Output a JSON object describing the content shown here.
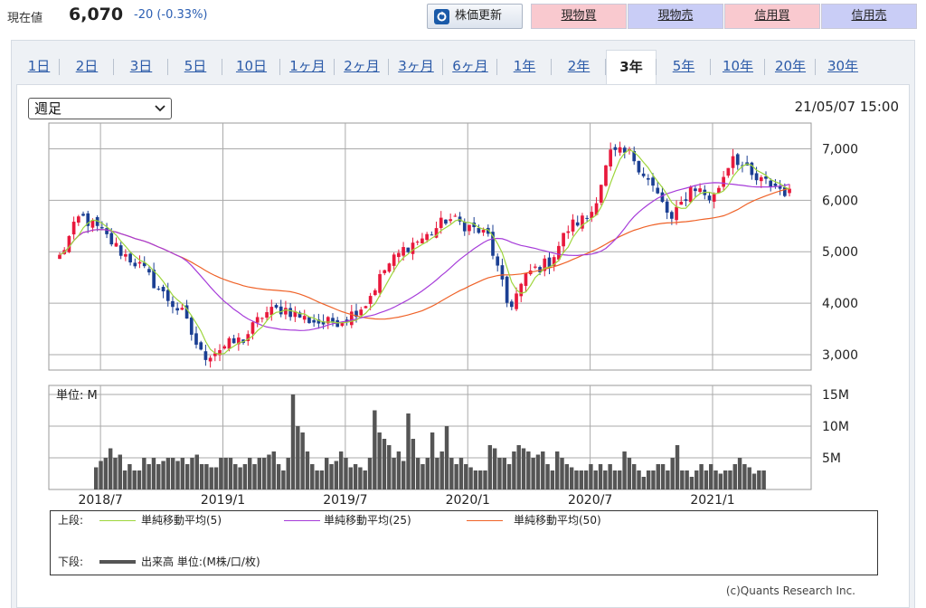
{
  "quote": {
    "price_label": "現在値",
    "price_value": "6,070",
    "price_change": "-20 (-0.33%)"
  },
  "buttons": {
    "refresh": "株価更新",
    "spot_buy": "現物買",
    "spot_sell": "現物売",
    "margin_buy": "信用買",
    "margin_sell": "信用売"
  },
  "tabs": [
    "1日",
    "2日",
    "3日",
    "5日",
    "10日",
    "1ヶ月",
    "2ヶ月",
    "3ヶ月",
    "6ヶ月",
    "1年",
    "2年",
    "3年",
    "5年",
    "10年",
    "20年",
    "30年"
  ],
  "active_tab": "3年",
  "interval_select": "週足",
  "timestamp": "21/05/07 15:00",
  "legend": {
    "upper_label": "上段:",
    "lower_label": "下段:",
    "ma5": "単純移動平均(5)",
    "ma25": "単純移動平均(25)",
    "ma50": "単純移動平均(50)",
    "volume": "出来高 単位:(M株/口/枚)"
  },
  "copyright": "(c)Quants Research Inc.",
  "colors": {
    "up": "#e8193c",
    "down": "#1b3f93",
    "ma5": "#9ed63c",
    "ma25": "#a63cd9",
    "ma50": "#ef6228",
    "volume": "#555555",
    "grid": "#aaaaaa"
  },
  "chart_data": [
    {
      "type": "candlestick",
      "title": "",
      "y_ticks": [
        "7,000",
        "6,000",
        "5,000",
        "4,000",
        "3,000"
      ],
      "y_tick_values": [
        7000,
        6000,
        5000,
        4000,
        3000
      ],
      "ylim": [
        2700,
        7500
      ],
      "x_ticks": [
        "2018/7",
        "2019/1",
        "2019/7",
        "2020/1",
        "2020/7",
        "2021/1"
      ],
      "x_range": [
        "2018/5",
        "2021/5"
      ],
      "keypoints": [
        {
          "date": "2018/5",
          "close": 4900
        },
        {
          "date": "2018/6",
          "close": 5700
        },
        {
          "date": "2018/7",
          "close": 5400
        },
        {
          "date": "2018/8",
          "close": 5000
        },
        {
          "date": "2018/9",
          "close": 4700
        },
        {
          "date": "2018/10",
          "close": 4200
        },
        {
          "date": "2018/11",
          "close": 3800
        },
        {
          "date": "2018/12",
          "close": 2950
        },
        {
          "date": "2019/1",
          "close": 3150
        },
        {
          "date": "2019/2",
          "close": 3300
        },
        {
          "date": "2019/3",
          "close": 3800
        },
        {
          "date": "2019/4",
          "close": 3900
        },
        {
          "date": "2019/5",
          "close": 3700
        },
        {
          "date": "2019/6",
          "close": 3600
        },
        {
          "date": "2019/7",
          "close": 3700
        },
        {
          "date": "2019/8",
          "close": 4000
        },
        {
          "date": "2019/9",
          "close": 4700
        },
        {
          "date": "2019/10",
          "close": 5100
        },
        {
          "date": "2019/11",
          "close": 5300
        },
        {
          "date": "2019/12",
          "close": 5650
        },
        {
          "date": "2020/1",
          "close": 5500
        },
        {
          "date": "2020/2",
          "close": 5300
        },
        {
          "date": "2020/3",
          "close": 3900
        },
        {
          "date": "2020/4",
          "close": 4600
        },
        {
          "date": "2020/5",
          "close": 4800
        },
        {
          "date": "2020/6",
          "close": 5500
        },
        {
          "date": "2020/7",
          "close": 5700
        },
        {
          "date": "2020/8",
          "close": 6900
        },
        {
          "date": "2020/9",
          "close": 6900
        },
        {
          "date": "2020/10",
          "close": 6300
        },
        {
          "date": "2020/11",
          "close": 5600
        },
        {
          "date": "2020/12",
          "close": 6300
        },
        {
          "date": "2021/1",
          "close": 6000
        },
        {
          "date": "2021/2",
          "close": 6900
        },
        {
          "date": "2021/3",
          "close": 6400
        },
        {
          "date": "2021/4",
          "close": 6300
        },
        {
          "date": "2021/5",
          "close": 6070
        }
      ]
    },
    {
      "type": "bar",
      "title": "",
      "unit_label": "単位: M",
      "y_ticks": [
        "15M",
        "10M",
        "5M"
      ],
      "y_tick_values": [
        15,
        10,
        5
      ],
      "ylim": [
        0,
        15
      ],
      "series": [
        {
          "values": [
            3.5,
            4.5,
            5,
            6.5,
            5,
            5.5,
            3,
            4,
            3,
            3,
            5,
            4,
            5,
            4,
            4.5,
            5,
            5,
            4.5,
            5,
            4,
            5,
            5.5,
            4,
            4,
            3.5,
            3.5,
            5,
            5,
            5,
            4,
            3.5,
            4,
            5,
            4,
            5,
            5,
            5.5,
            6,
            4,
            3,
            5,
            15,
            10,
            9,
            6,
            4,
            3,
            3,
            5,
            4,
            4.5,
            6,
            5,
            3.5,
            4,
            3.5,
            3,
            5,
            12.5,
            9,
            8,
            7,
            5,
            6,
            4.5,
            12,
            8,
            5,
            4,
            5,
            9,
            5,
            6,
            10,
            5,
            4,
            5,
            4,
            3.5,
            3,
            3,
            3,
            7,
            6.5,
            5,
            5,
            4,
            6,
            7,
            6.5,
            6,
            5,
            5.5,
            6,
            4,
            3,
            6,
            5,
            4,
            3.5,
            3,
            3,
            3,
            4,
            3,
            4,
            3,
            4,
            3,
            3,
            6,
            5,
            4,
            3,
            2,
            3,
            3,
            4,
            4,
            3,
            5,
            7,
            3,
            3,
            2,
            3,
            4,
            3,
            4,
            3,
            2.5,
            3,
            3,
            4,
            5,
            4,
            3.5,
            2.5,
            3,
            3,
            3,
            4,
            3,
            4,
            5,
            3,
            2,
            1.5
          ]
        }
      ]
    }
  ]
}
